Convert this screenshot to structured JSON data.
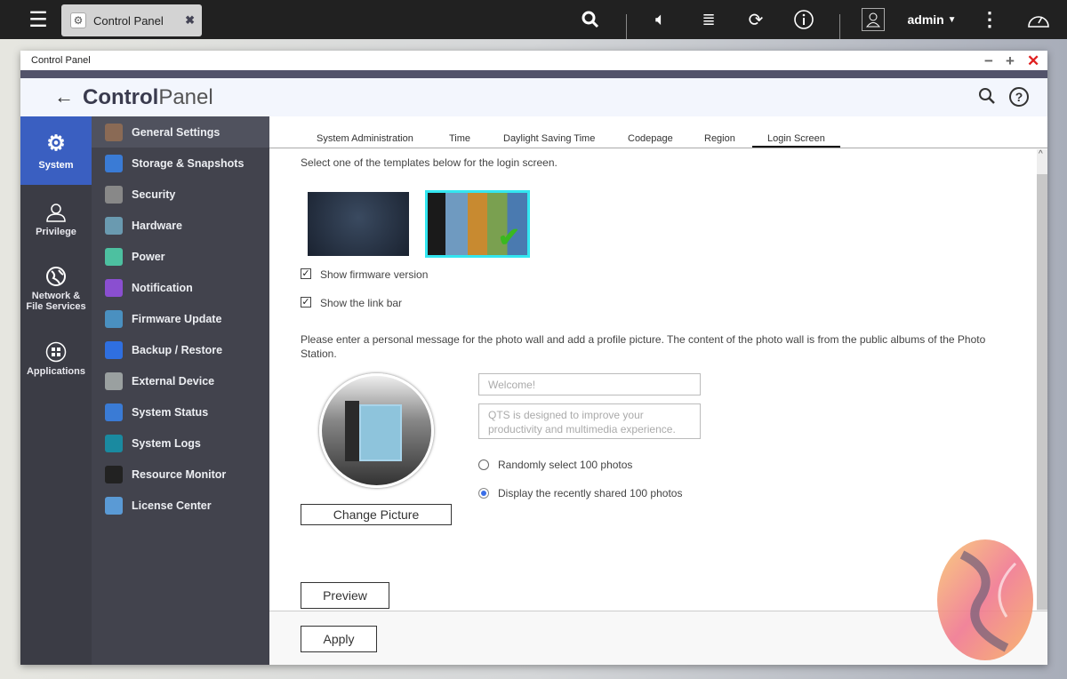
{
  "taskbar": {
    "tab_label": "Control Panel",
    "user": "admin",
    "icons": [
      "menu-icon",
      "search-icon",
      "volume-icon",
      "stack-icon",
      "sync-icon",
      "info-icon",
      "user-icon",
      "more-icon",
      "dashboard-icon"
    ]
  },
  "window": {
    "title": "Control Panel",
    "header_bold": "Control",
    "header_light": "Panel"
  },
  "rail": [
    {
      "label": "System",
      "icon": "gear-icon"
    },
    {
      "label": "Privilege",
      "icon": "user-icon"
    },
    {
      "label": "Network & File Services",
      "icon": "globe-icon"
    },
    {
      "label": "Applications",
      "icon": "apps-icon"
    }
  ],
  "menu": [
    {
      "label": "General Settings",
      "color": "#8a6a55"
    },
    {
      "label": "Storage & Snapshots",
      "color": "#3a7bd5"
    },
    {
      "label": "Security",
      "color": "#888888"
    },
    {
      "label": "Hardware",
      "color": "#6a9ab0"
    },
    {
      "label": "Power",
      "color": "#4dc0a0"
    },
    {
      "label": "Notification",
      "color": "#8a4fd0"
    },
    {
      "label": "Firmware Update",
      "color": "#4a90c0"
    },
    {
      "label": "Backup / Restore",
      "color": "#2f6fe0"
    },
    {
      "label": "External Device",
      "color": "#9aa0a0"
    },
    {
      "label": "System Status",
      "color": "#3a7bd5"
    },
    {
      "label": "System Logs",
      "color": "#1a8aa0"
    },
    {
      "label": "Resource Monitor",
      "color": "#222222"
    },
    {
      "label": "License Center",
      "color": "#5a9ad5"
    }
  ],
  "tabs": [
    "System Administration",
    "Time",
    "Daylight Saving Time",
    "Codepage",
    "Region",
    "Login Screen"
  ],
  "login": {
    "intro": "Select one of the templates below for the login screen.",
    "show_firmware": "Show firmware version",
    "show_link_bar": "Show the link bar",
    "photo_wall_text": "Please enter a personal message for the photo wall and add a profile picture. The content of the photo wall is from the public albums of the Photo Station.",
    "title_placeholder": "Welcome!",
    "message_placeholder": "QTS is designed to improve your productivity and multimedia experience.",
    "radio_random": "Randomly select 100 photos",
    "radio_recent": "Display the recently shared 100 photos",
    "change_picture": "Change Picture",
    "preview": "Preview",
    "apply": "Apply"
  },
  "colors": {
    "accent": "#3a5fc1",
    "selected_border": "#33e6f0"
  }
}
